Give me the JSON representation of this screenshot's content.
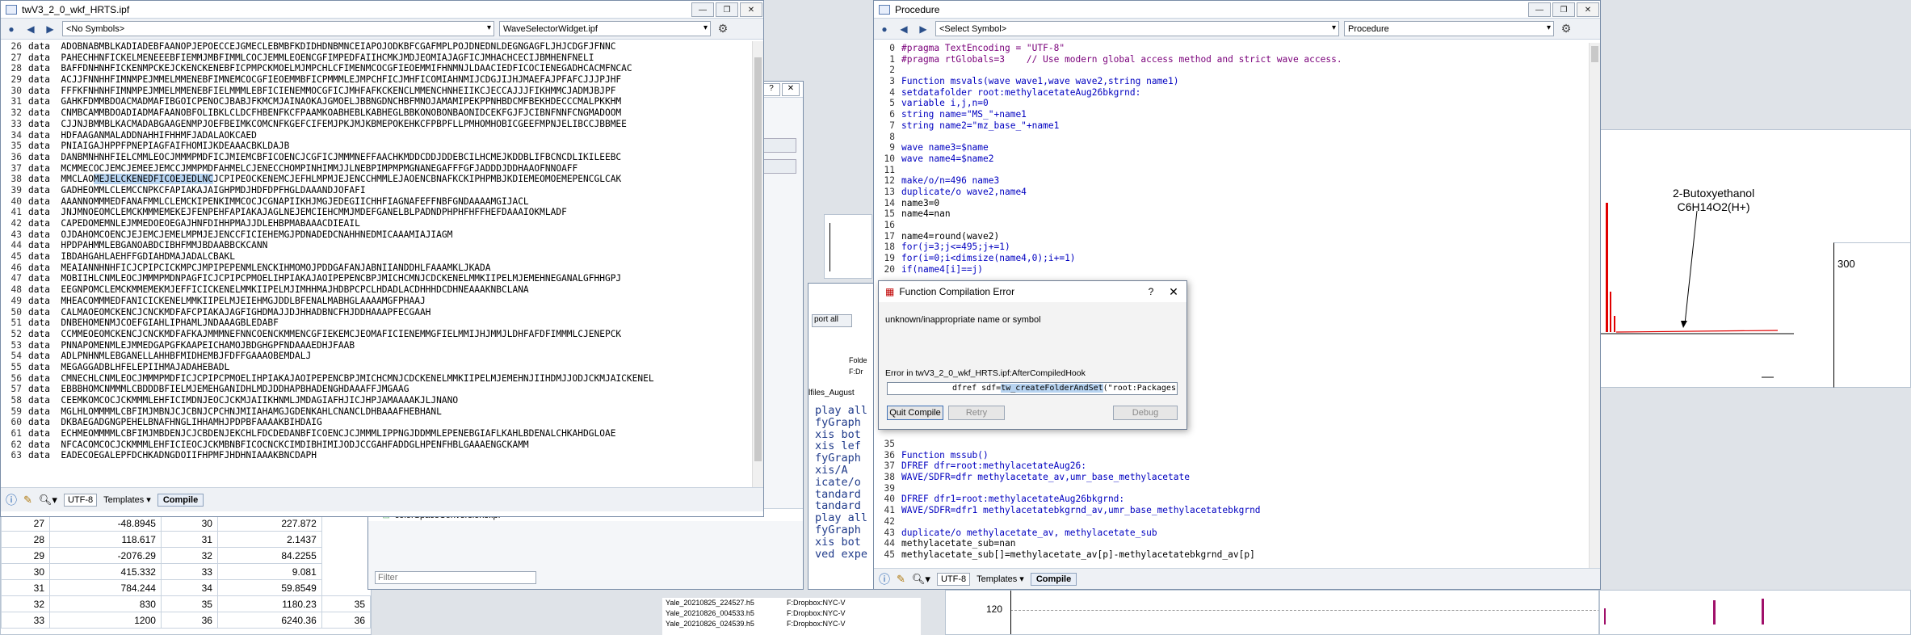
{
  "left_window": {
    "title": "twV3_2_0_wkf_HRTS.ipf",
    "symbols": "<No Symbols>",
    "widget": "WaveSelectorWidget.ipf",
    "encoding": "UTF-8",
    "templates": "Templates",
    "compile": "Compile",
    "lines": [
      {
        "n": "26",
        "t": "data  ADOBNABMBLKADIADEBFAANOPJEPOECCEJGMECLEBMBFKDIDHDNBMNCEIAPOJODKBFCGAFMPLPOJDNEDNLDEGNGAGFLJHJCDGFJFNNC"
      },
      {
        "n": "27",
        "t": "data  PAHECHHNFICKELMENEEEBFIEMMJMBFIMMLCOCJEMMLEOENCGFIMPEDFAIIHCMKJMDJEOMIAJAGFICJMHACHCECIJBMHENFNELI"
      },
      {
        "n": "28",
        "t": "data  BAFFDNHNHFICKENMPCKEJCKENCKENEBFICPMPCKMOELMJMPCHLCFIMENMCOCGFIEOEMMIFHNMNJLDAACIEDFICOCIENEGADHCACMFNCAC"
      },
      {
        "n": "29",
        "t": "data  ACJJFNNHHFIMNMPEJMMELMMENEBFIMNEMCOCGFIEOEMMBFICPMMMLEJMPCHFICJMHFICOMIAHNMIJCDGJIJHJMAEFAJPFAFCJJJPJHF"
      },
      {
        "n": "30",
        "t": "data  FFFKFNHNHFIMNMPEJMMELMMENEBFIELMMMLEBFICIENEMMOCGFICJMHFAFKCKENCLMMENCHNHEIIKCJECCAJJJFIKHMMCJADMJBJPF"
      },
      {
        "n": "31",
        "t": "data  GAHKFDMMBDOACMADMAFIBGOICPENOCJBABJFKMCMJAINAOKAJGMOELJBBNGDNCHBFMNOJAMAMIPEKPPNHBDCMFBEKHDECCCMALPKKHM"
      },
      {
        "n": "32",
        "t": "data  CNMBCAMMBDOADIADMAFAANOBFOLIBKLCLDCFHBENFKCFPAAMKOABHEBLKABHEGLBBKONOBONBAONIDCEKFGJFJCIBNFNNFCNGMADOOM"
      },
      {
        "n": "33",
        "t": "data  CJJNJBMMBLKACMADABGAAGENMPJOEFBEIMKCOMCNFKGEFCIFEMJPKJMJKBMEPOKEHKCFPBPFLLPMHOMHOBICGEEFMPNJELIBCCJBBMEE"
      },
      {
        "n": "34",
        "t": "data  HDFAAGANMALADDNAHHIFHHMFJADALAOKCAED"
      },
      {
        "n": "35",
        "t": "data  PNIAIGAJHPPFPNEPIAGFAIFHOMIJKDEAAACBKLDAJB"
      },
      {
        "n": "36",
        "t": "data  DANBMNHNHFIELCMMLEOCJMMMPMDFICJMIEMCBFICOENCJCGFICJMMMNEFFAACHKMDDCDDJDDEBCILHCMEJKDDBLIFBCNCDLIKILEEBC"
      },
      {
        "n": "37",
        "t": "data  MCMMECOCJEMCJEMEEJEMCCJMMPMDFAHMELCJENECCHOMPINHIMMJJLNEBPIMPMPMGNANEGAFFFGFJADDDJDDHAAOFNNOAFF"
      },
      {
        "n": "38",
        "t": "data  MMCLAOMEJELCKENEDFICOEJEDLNCJCPIPEOCKENEMCJEFHLMPMJEJENCCHMMLEJAOENCBNAFKCKIPHPMBJKDIEMEOMOEMEPENCGLCAK"
      },
      {
        "n": "39",
        "t": "data  GADHEOMMLCLEMCCNPKCFAPIAKAJAIGHPMDJHDFDPFHGLDAAANDJOFAFI"
      },
      {
        "n": "40",
        "t": "data  AAANNOMMMEDFANAFMMLCLEMCKIPENKIMMCOCJCGNAPIIKHJMGJEDEGIICHHFIAGNAFEFFNBFGNDAAAAMGIJACL"
      },
      {
        "n": "41",
        "t": "data  JNJMNOEOMCLEMCKMMMEMEKEJFENPEHFAPIAKAJAGLNEJEMCIEHCMMJMDEFGANELBLPADNDPHPHFHFFHEFDAAAIOKMLADF"
      },
      {
        "n": "42",
        "t": "data  CAPEDOMEMNLEJMMEDOEOEGAJHNFDIHHPMAJJDLEHBPMABAAACDIEAIL"
      },
      {
        "n": "43",
        "t": "data  OJDAHOMCOENCJEJEMCJEMELMPMJEJENCCFICIEHEMGJPDNADEDCNAHHNEDMICAAAMIAJIAGM"
      },
      {
        "n": "44",
        "t": "data  HPDPAHMMLEBGANOABDCIBHFMMJBDAABBCKCANN"
      },
      {
        "n": "45",
        "t": "data  IBDAHGAHLAEHFFGDIAHDMAJADALCBAKL"
      },
      {
        "n": "46",
        "t": "data  MEAIANNHNHFICJCPIPCICKMPCJMPIPEPENMLENCKIHMOMOJPDDGAFANJABNIIANDDHLFAAAMKLJKADA"
      },
      {
        "n": "47",
        "t": "data  MOBIIHLCNMLEOCJMMMPMDNPAGFICJCPIPCPMOELIHPIAKAJAOIPEPENCBPJMICHCMNJCDCKENELMMKIIPELMJEMEHNEGANALGFHHGPJ"
      },
      {
        "n": "48",
        "t": "data  EEGNPOMCLEMCKMMEMEKMJEFFICICKENELMMKIIPELMJIMHHMAJHDBPCPCLHDADLACDHHHDCDHNEAAAKNBCLANA"
      },
      {
        "n": "49",
        "t": "data  MHEACOMMMEDFANICICKENELMMKIIPELMJEIEHMGJDDLBFENALMABHGLAAAAMGFPHAAJ"
      },
      {
        "n": "50",
        "t": "data  CALMAOEOMCKENCJCNCKMDFAFCPIAKAJAGFIGHDMAJJDJHHADBNCFHJDDHAAAPFECGAAH"
      },
      {
        "n": "51",
        "t": "data  DNBEHOMENMJCOEFGIAHLIPHAMLJNDAAAGBLEDABF"
      },
      {
        "n": "52",
        "t": "data  CCMMEOEOMCKENCJCNCKMDFAFKAJMMMNEFNNCOENCKMMENCGFIEKEMCJEOMAFICIENEMMGFIELMMIJHJMMJLDHFAFDFIMMMLCJENEPCK"
      },
      {
        "n": "53",
        "t": "data  PNNAPOMENMLEJMMEDGAPGFKAAPEICHAMOJBDGHGPFNDAAAEDHJFAAB"
      },
      {
        "n": "54",
        "t": "data  ADLPNHNMLEBGANELLAHHBFMIDHEMBJFDFFGAAAOBEMDALJ"
      },
      {
        "n": "55",
        "t": "data  MEGAGGADBLHFELEPIIHMAJADAHEBADL"
      },
      {
        "n": "56",
        "t": "data  CMNECHLCNMLEOCJMMMPMDFICJCPIPCPMOELIHPIAKAJAOIPEPENCBPJMICHCMNJCDCKENELMMKIIPELMJEMEHNJIIHDMJJODJCKMJAICKENEL"
      },
      {
        "n": "57",
        "t": "data  EBBBHOMCNMMMLCBDDDBFIELMJEMEHGANIDHLMDJDDHAPBHADENGHDAAAFFJMGAAG"
      },
      {
        "n": "58",
        "t": "data  CEEMKOMCOCJCKMMMLEHFICIMDNJEOCJCKMJAIIKHNMLJMDAGIAFHJICJHPJAMAAAAKJLJNANO"
      },
      {
        "n": "59",
        "t": "data  MGLHLOMMMMLCBFIMJMBNJCJCBNJCPCHNJMIIAHAMGJGDENKAHLCNANCLDHBAAAFHEBHANL"
      },
      {
        "n": "60",
        "t": "data  DKBAEGADGNGPEHELBNAFHNGLIHHAMHJPDPBFAAAAKBIHDAIG"
      },
      {
        "n": "61",
        "t": "data  ECHMEOMMMMLCBFIMJMBDENJCJCBDENJEKCHLFDCDEDANBFICOENCJCJMMMLIPPNGJDDMMLEPENEBGIAFLKAHLBDENALCHKAHDGLOAE"
      },
      {
        "n": "62",
        "t": "data  NFCACOMCOCJCKMMMLEHFICIEOCJCKMBNBFICOCNCKCIMDIBHIMIJODJCCGAHFADDGLHPENFHBLGAAAENGCKAMM"
      },
      {
        "n": "63",
        "t": "data  EADECOEGALEPFDCHKADNGDOIIFHPMFJHDHNIAAAKBNCDAPH"
      }
    ]
  },
  "table": {
    "rows": [
      [
        "27",
        "-48.8945",
        "30",
        "227.872"
      ],
      [
        "28",
        "118.617",
        "31",
        "2.1437"
      ],
      [
        "29",
        "-2076.29",
        "32",
        "84.2255"
      ],
      [
        "30",
        "415.332",
        "33",
        "9.081"
      ],
      [
        "31",
        "784.244",
        "34",
        "59.8549"
      ],
      [
        "32",
        "830",
        "35",
        "1180.23",
        "35"
      ],
      [
        "33",
        "1200",
        "36",
        "6240.36",
        "36"
      ]
    ]
  },
  "middle_panel": {
    "file": "colorSpaceConversions.ipf",
    "filter_placeholder": "Filter",
    "report_btn": "port all",
    "folder_label": "Folde",
    "folder_prefix": "F:Dr",
    "files_label": "lfiles_August",
    "fragments": [
      "play all",
      "fyGraph",
      "xis bot",
      "xis lef",
      "fyGraph",
      "xis/A",
      "icate/o",
      "tandard",
      "tandard",
      "play all",
      "fyGraph",
      "xis bot",
      "ved expe"
    ]
  },
  "files_list": [
    {
      "name": "Yale_20210825_224527.h5",
      "path": "F:Dropbox:NYC-V"
    },
    {
      "name": "Yale_20210826_004533.h5",
      "path": "F:Dropbox:NYC-V"
    },
    {
      "name": "Yale_20210826_024539.h5",
      "path": "F:Dropbox:NYC-V"
    }
  ],
  "procedure": {
    "title": "Procedure",
    "symbols": "<Select Symbol>",
    "procedure_name": "Procedure",
    "encoding": "UTF-8",
    "templates": "Templates",
    "compile": "Compile",
    "lines_top": [
      {
        "n": "0",
        "t": "#pragma TextEncoding = \"UTF-8\""
      },
      {
        "n": "1",
        "t": "#pragma rtGlobals=3    // Use modern global access method and strict wave access."
      },
      {
        "n": "2",
        "t": ""
      },
      {
        "n": "3",
        "t": "Function msvals(wave wave1,wave wave2,string name1)"
      },
      {
        "n": "4",
        "t": "setdatafolder root:methylacetateAug26bkgrnd:"
      },
      {
        "n": "5",
        "t": "variable i,j,n=0"
      },
      {
        "n": "6",
        "t": "string name=\"MS_\"+name1"
      },
      {
        "n": "7",
        "t": "string name2=\"mz_base_\"+name1"
      },
      {
        "n": "8",
        "t": ""
      },
      {
        "n": "9",
        "t": "wave name3=$name"
      },
      {
        "n": "10",
        "t": "wave name4=$name2"
      },
      {
        "n": "11",
        "t": ""
      },
      {
        "n": "12",
        "t": "make/o/n=496 name3"
      },
      {
        "n": "13",
        "t": "duplicate/o wave2,name4"
      },
      {
        "n": "14",
        "t": "name3=0"
      },
      {
        "n": "15",
        "t": "name4=nan"
      },
      {
        "n": "16",
        "t": ""
      },
      {
        "n": "17",
        "t": "name4=round(wave2)"
      },
      {
        "n": "18",
        "t": "for(j=3;j<=495;j+=1)"
      },
      {
        "n": "19",
        "t": "for(i=0;i<dimsize(name4,0);i+=1)"
      },
      {
        "n": "20",
        "t": "if(name4[i]==j)"
      }
    ],
    "lines_bottom": [
      {
        "n": "35",
        "t": ""
      },
      {
        "n": "36",
        "t": "Function mssub()"
      },
      {
        "n": "37",
        "t": "DFREF dfr=root:methylacetateAug26:"
      },
      {
        "n": "38",
        "t": "WAVE/SDFR=dfr methylacetate_av,umr_base_methylacetate"
      },
      {
        "n": "39",
        "t": ""
      },
      {
        "n": "40",
        "t": "DFREF dfr1=root:methylacetateAug26bkgrnd:"
      },
      {
        "n": "41",
        "t": "WAVE/SDFR=dfr1 methylacetatebkgrnd_av,umr_base_methylacetatebkgrnd"
      },
      {
        "n": "42",
        "t": ""
      },
      {
        "n": "43",
        "t": "duplicate/o methylacetate_av, methylacetate_sub"
      },
      {
        "n": "44",
        "t": "methylacetate_sub=nan"
      },
      {
        "n": "45",
        "t": "methylacetate_sub[]=methylacetate_av[p]-methylacetatebkgrnd_av[p]"
      }
    ]
  },
  "dialog": {
    "title": "Function Compilation Error",
    "help": "?",
    "message": "unknown/inappropriate name or symbol",
    "error_in": "Error in  twV3_2_0_wkf_HRTS.ipf:AfterCompiledHook",
    "code_before": "dfref sdf=",
    "code_highlight": "tw_createFolderAndSet",
    "code_after": "(\"root:Packages:tw_wk",
    "quit": "Quit Compile",
    "retry": "Retry",
    "debug": "Debug"
  },
  "graph": {
    "annotation_line1": "2-Butoxyethanol",
    "annotation_line2": "C6H14O2(H+)",
    "axis_300": "300",
    "axis_120": "120"
  }
}
